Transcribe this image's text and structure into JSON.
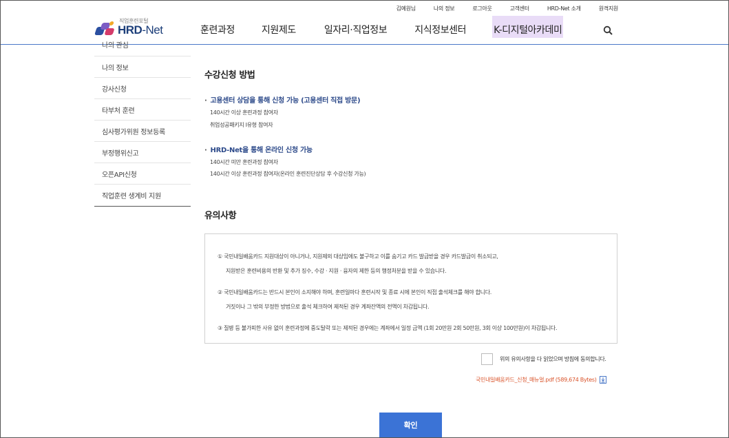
{
  "util_links": [
    "김예원님",
    "나의 정보",
    "로그아웃",
    "고객센터",
    "HRD-Net 소개",
    "원격지원"
  ],
  "logo": {
    "sub": "직업훈련포털",
    "brand_main": "HRD",
    "brand_rest": "-Net",
    "colors": [
      "#2b4fa1",
      "#d43b6a",
      "#f2a92a",
      "#7c5cc4"
    ]
  },
  "gnb": [
    "훈련과정",
    "지원제도",
    "일자리·직업정보",
    "지식정보센터",
    "K-디지털아카데미"
  ],
  "sidebar": [
    "나의 관심",
    "나의 정보",
    "강사신청",
    "타부처 훈련",
    "심사평가위원 정보등록",
    "부정행위신고",
    "오픈API신청",
    "직업훈련 생계비 지원"
  ],
  "apply": {
    "title": "수강신청 방법",
    "groups": [
      {
        "title": "고용센터 상담을 통해 신청 가능 (고용센터 직접 방문)",
        "lines": [
          "140시간 이상 훈련과정 참여자",
          "취업성공패키지 Ⅰ유형 참여자"
        ]
      },
      {
        "title": "HRD-Net을 통해 온라인 신청 가능",
        "lines": [
          "140시간 미만 훈련과정 참여자",
          "140시간 이상 훈련과정 참여자(온라인 훈련진단상담 후 수강신청 가능)"
        ]
      }
    ]
  },
  "notice": {
    "title": "유의사항",
    "items": [
      [
        "① 국민내일배움카드 지원대상이 아니거나, 지원제외 대상임에도 불구하고 이를 숨기고 카드 발급받을 경우 카드발급이 취소되고,",
        "지원받은 훈련비용의 반환 및 추가 징수, 수강 · 지원 · 융자의 제한 등의 행정처분을 받을 수 있습니다."
      ],
      [
        "② 국민내일배움카드는 반드시 본인이 소지해야 하며, 훈련일마다 훈련시작 및 종료 시에 본인이 직접 출석체크를 해야 합니다.",
        "거짓이나 그 밖의 부정한 방법으로 출석 체크하여 제적된 경우 계좌잔액의 전액이 차감됩니다."
      ],
      [
        "③ 질병 등 불가피한 사유 없이 훈련과정에 중도탈락 또는 제적된 경우에는 계좌에서 일정 금액 (1회 20만원 2회 50만원, 3회 이상 100만원)이 차감됩니다."
      ]
    ]
  },
  "agree_label": "위의 유의사항을 다 읽었으며 방침에 동의합니다.",
  "pdf_link": "국민내일배움카드_신청_매뉴얼.pdf (589,674 Bytes)",
  "confirm_label": "확인"
}
